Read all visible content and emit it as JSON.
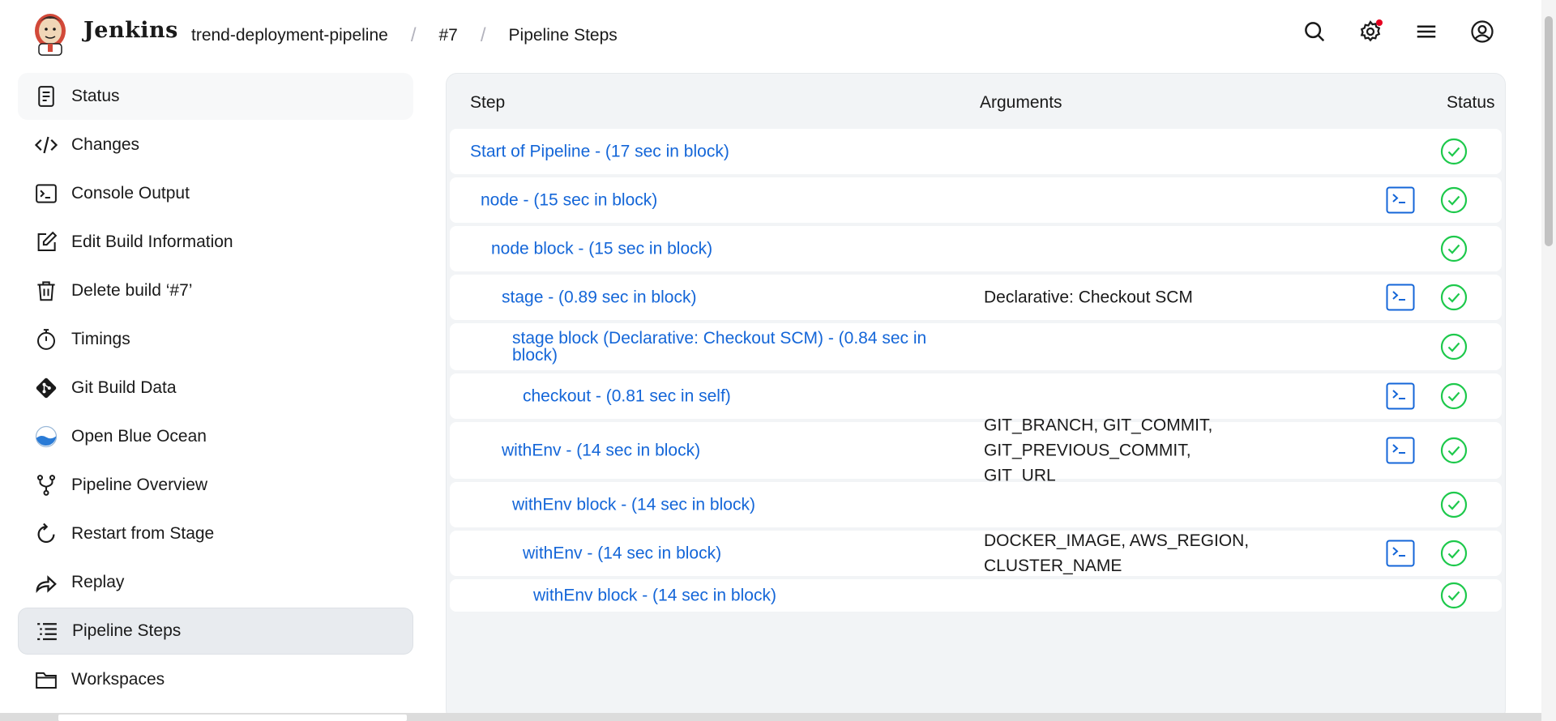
{
  "header": {
    "brand": "Jenkins",
    "breadcrumbs": [
      "trend-deployment-pipeline",
      "#7",
      "Pipeline Steps"
    ],
    "icons": [
      "search-icon",
      "settings-icon",
      "menu-icon",
      "user-icon"
    ],
    "notification_color": "#e6001f"
  },
  "sidebar": {
    "items": [
      {
        "label": "Status",
        "icon": "status-icon"
      },
      {
        "label": "Changes",
        "icon": "code-icon"
      },
      {
        "label": "Console Output",
        "icon": "terminal-icon"
      },
      {
        "label": "Edit Build Information",
        "icon": "edit-icon"
      },
      {
        "label": "Delete build ‘#7’",
        "icon": "trash-icon"
      },
      {
        "label": "Timings",
        "icon": "stopwatch-icon"
      },
      {
        "label": "Git Build Data",
        "icon": "git-icon"
      },
      {
        "label": "Open Blue Ocean",
        "icon": "blue-ocean-icon"
      },
      {
        "label": "Pipeline Overview",
        "icon": "pipeline-fork-icon"
      },
      {
        "label": "Restart from Stage",
        "icon": "restart-icon"
      },
      {
        "label": "Replay",
        "icon": "replay-icon"
      },
      {
        "label": "Pipeline Steps",
        "icon": "list-icon",
        "active": true
      },
      {
        "label": "Workspaces",
        "icon": "folder-icon"
      }
    ]
  },
  "table": {
    "columns": {
      "step": "Step",
      "arguments": "Arguments",
      "status": "Status"
    },
    "rows": [
      {
        "step": "Start of Pipeline - (17 sec in block)",
        "args": "",
        "console": false,
        "status": "success"
      },
      {
        "step": "node - (15 sec in block)",
        "args": "",
        "console": true,
        "status": "success"
      },
      {
        "step": "node block - (15 sec in block)",
        "args": "",
        "console": false,
        "status": "success"
      },
      {
        "step": "stage - (0.89 sec in block)",
        "args": "Declarative: Checkout SCM",
        "console": true,
        "status": "success"
      },
      {
        "step": "stage block (Declarative: Checkout SCM) - (0.84 sec in block)",
        "args": "",
        "console": false,
        "status": "success"
      },
      {
        "step": "checkout - (0.81 sec in self)",
        "args": "",
        "console": true,
        "status": "success"
      },
      {
        "step": "withEnv - (14 sec in block)",
        "args": "GIT_BRANCH, GIT_COMMIT, GIT_PREVIOUS_COMMIT, GIT_URL",
        "console": true,
        "status": "success"
      },
      {
        "step": "withEnv block - (14 sec in block)",
        "args": "",
        "console": false,
        "status": "success"
      },
      {
        "step": "withEnv - (14 sec in block)",
        "args": "DOCKER_IMAGE, AWS_REGION, CLUSTER_NAME",
        "console": true,
        "status": "success"
      },
      {
        "step": "withEnv block - (14 sec in block)",
        "args": "",
        "console": false,
        "status": "success"
      }
    ]
  },
  "colors": {
    "link": "#1466d8",
    "success": "#1ec94c",
    "console": "#1466d8"
  }
}
